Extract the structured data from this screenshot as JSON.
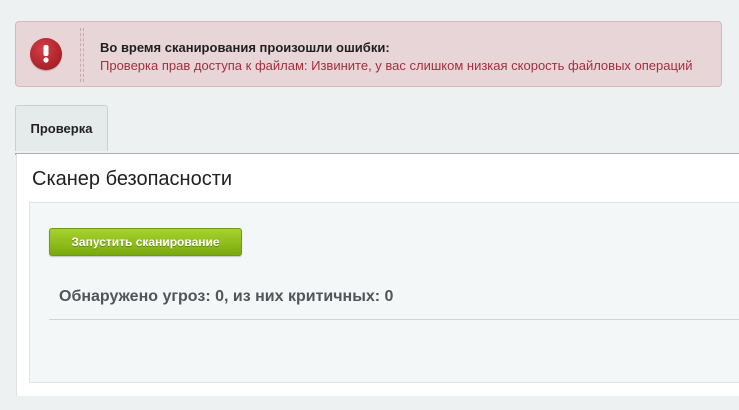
{
  "error": {
    "icon": "exclamation-icon",
    "color": "#b5262e",
    "title": "Во время сканирования произошли ошибки:",
    "message": "Проверка прав доступа к файлам: Извините, у вас слишком низкая скорость файловых операций"
  },
  "tabs": [
    {
      "label": "Проверка",
      "active": true
    }
  ],
  "panel": {
    "title": "Сканер безопасности",
    "scan_button_label": "Запустить сканирование",
    "scan_button_color": "#8fbd1c",
    "threats_text": "Обнаружено угроз: 0, из них критичных: 0"
  }
}
